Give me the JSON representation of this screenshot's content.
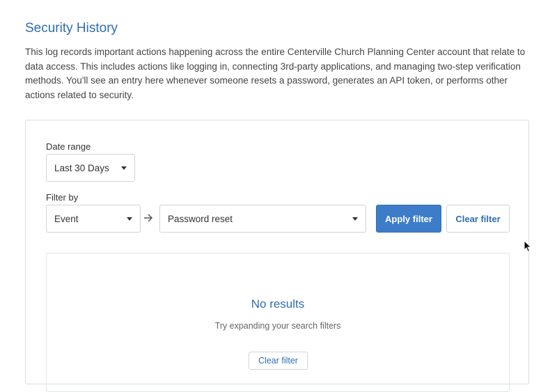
{
  "header": {
    "title": "Security History",
    "description": "This log records important actions happening across the entire Centerville Church Planning Center account that relate to data access. This includes actions like logging in, connecting 3rd-party applications, and managing two-step verification methods. You'll see an entry here whenever someone resets a password, generates an API token, or performs other actions related to security."
  },
  "filters": {
    "date_range_label": "Date range",
    "date_range_value": "Last 30 Days",
    "filter_by_label": "Filter by",
    "filter_field_value": "Event",
    "filter_value": "Password reset",
    "apply_label": "Apply filter",
    "clear_label": "Clear filter"
  },
  "results": {
    "title": "No results",
    "subtitle": "Try expanding your search filters",
    "clear_label": "Clear filter"
  },
  "icons": {
    "arrow": "arrow-right-icon",
    "caret": "caret-down-icon",
    "cursor": "mouse-pointer-icon"
  },
  "colors": {
    "accent": "#2f6db1",
    "primary_button": "#3d7cc9",
    "border": "#cfd4d9"
  }
}
